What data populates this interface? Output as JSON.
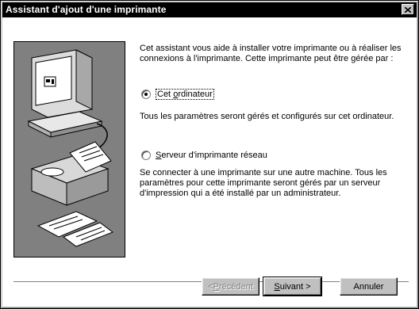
{
  "window": {
    "title": "Assistant d'ajout d'une imprimante"
  },
  "intro_text": "Cet assistant vous aide à installer votre imprimante ou à réaliser les connexions à l'imprimante. Cette imprimante peut être gérée par :",
  "options": [
    {
      "label_prefix": "Cet ",
      "label_accel": "o",
      "label_rest": "rdinateur",
      "checked": true,
      "description": "Tous les paramètres seront gérés et configurés sur cet ordinateur."
    },
    {
      "label_prefix": "",
      "label_accel": "S",
      "label_rest": "erveur d'imprimante réseau",
      "checked": false,
      "description": "Se connecter à une imprimante sur une autre machine. Tous les paramètres pour cette imprimante seront gérés par un serveur d'impression qui a été installé par un administrateur."
    }
  ],
  "buttons": {
    "back_pre": "< ",
    "back_accel": "P",
    "back_rest": "récédent",
    "next_accel": "S",
    "next_rest": "uivant >",
    "cancel": "Annuler"
  },
  "icons": {
    "close": "close-icon",
    "illustration": "computer-printer-illustration"
  },
  "colors": {
    "title_bar": "#000000",
    "face": "#c0c0c0",
    "panel": "#808080"
  }
}
